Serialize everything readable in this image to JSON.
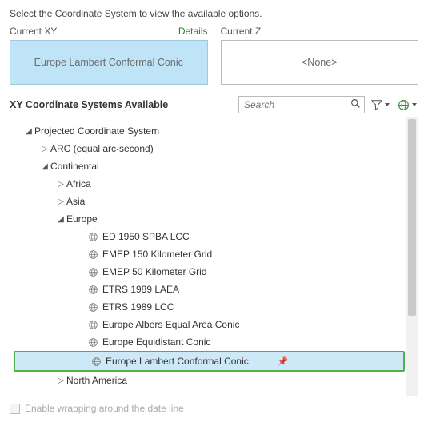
{
  "instruction": "Select the Coordinate System to view the available options.",
  "current_xy_label": "Current XY",
  "details_label": "Details",
  "current_z_label": "Current Z",
  "current_xy_value": "Europe Lambert Conformal Conic",
  "current_z_value": "<None>",
  "available_title": "XY Coordinate Systems Available",
  "search_placeholder": "Search",
  "tree": {
    "root_label": "Projected Coordinate System",
    "arc_label": "ARC (equal arc-second)",
    "continental_label": "Continental",
    "africa_label": "Africa",
    "asia_label": "Asia",
    "europe_label": "Europe",
    "north_america_label": "North America",
    "items": [
      "ED 1950 SPBA LCC",
      "EMEP 150 Kilometer Grid",
      "EMEP 50 Kilometer Grid",
      "ETRS 1989 LAEA",
      "ETRS 1989 LCC",
      "Europe Albers Equal Area Conic",
      "Europe Equidistant Conic",
      "Europe Lambert Conformal Conic"
    ]
  },
  "selected_item": "Europe Lambert Conformal Conic",
  "wrap_label": "Enable wrapping around the date line"
}
